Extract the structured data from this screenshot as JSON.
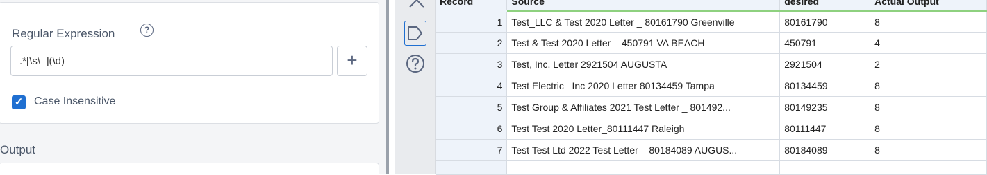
{
  "regex_panel": {
    "label": "Regular Expression",
    "help_glyph": "?",
    "input_value": ".*[\\s\\_](\\d)",
    "add_glyph": "+",
    "case_insensitive_label": "Case Insensitive",
    "case_insensitive_checked": true,
    "check_glyph": "✓"
  },
  "output_section": {
    "label": "Output"
  },
  "side_toolbar": {
    "icons": [
      "metadata-icon",
      "tag-icon",
      "help-icon"
    ],
    "active_color": "#1f6fd1"
  },
  "grid": {
    "columns": [
      "Record",
      "Source",
      "desired",
      "Actual Output"
    ],
    "rows": [
      {
        "record": "1",
        "source": "Test_LLC & Test 2020 Letter _ 80161790 Greenville",
        "desired": "80161790",
        "actual": "8"
      },
      {
        "record": "2",
        "source": "Test & Test 2020 Letter _ 450791 VA BEACH",
        "desired": "450791",
        "actual": "4"
      },
      {
        "record": "3",
        "source": "Test, Inc. Letter 2921504 AUGUSTA",
        "desired": "2921504",
        "actual": "2"
      },
      {
        "record": "4",
        "source": "Test Electric_ Inc 2020 Letter 80134459 Tampa",
        "desired": "80134459",
        "actual": "8"
      },
      {
        "record": "5",
        "source": "Test Group & Affiliates 2021 Test Letter _  801492...",
        "desired": "80149235",
        "actual": "8"
      },
      {
        "record": "6",
        "source": "Test Test 2020 Letter_80111447 Raleigh",
        "desired": "80111447",
        "actual": "8"
      },
      {
        "record": "7",
        "source": "Test Test Ltd 2022 Test Letter – 80184089 AUGUS...",
        "desired": "80184089",
        "actual": "8"
      }
    ]
  },
  "colors": {
    "accent": "#1f6fd1",
    "header_highlight": "#8ed17f",
    "panel_bg": "#f4f5f7"
  }
}
